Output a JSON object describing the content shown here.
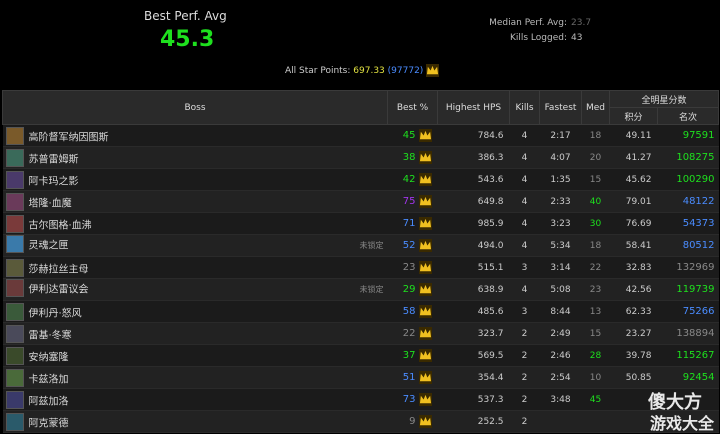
{
  "summary": {
    "best_perf_label": "Best Perf. Avg",
    "best_perf_value": "45.3",
    "median_label": "Median Perf. Avg:",
    "median_value": "23.7",
    "kills_label": "Kills Logged:",
    "kills_value": "43",
    "allstar_label": "All Star Points:",
    "allstar_points": "697.33",
    "allstar_rank": "(97772)"
  },
  "table": {
    "headers": {
      "boss": "Boss",
      "best": "Best %",
      "hps": "Highest HPS",
      "kills": "Kills",
      "fastest": "Fastest",
      "med": "Med",
      "allstar_group": "全明星分数",
      "points": "积分",
      "rank": "名次"
    },
    "rows": [
      {
        "name": "高阶督军纳因图斯",
        "icon_color": "#7a5a2a",
        "locked": "",
        "best": "45",
        "best_color": "#1ee01e",
        "hps": "784.6",
        "kills": "4",
        "fastest": "2:17",
        "med": "18",
        "med_color": "#888888",
        "points": "49.11",
        "rank": "97591",
        "rank_color": "#1ee01e"
      },
      {
        "name": "苏普雷姆斯",
        "icon_color": "#3a6a5a",
        "locked": "",
        "best": "38",
        "best_color": "#1ee01e",
        "hps": "386.3",
        "kills": "4",
        "fastest": "4:07",
        "med": "20",
        "med_color": "#888888",
        "points": "41.27",
        "rank": "108275",
        "rank_color": "#1ee01e"
      },
      {
        "name": "阿卡玛之影",
        "icon_color": "#4a3a6a",
        "locked": "",
        "best": "42",
        "best_color": "#1ee01e",
        "hps": "543.6",
        "kills": "4",
        "fastest": "1:35",
        "med": "15",
        "med_color": "#888888",
        "points": "45.62",
        "rank": "100290",
        "rank_color": "#1ee01e"
      },
      {
        "name": "塔隆·血魔",
        "icon_color": "#6a3a5a",
        "locked": "",
        "best": "75",
        "best_color": "#a335ee",
        "hps": "649.8",
        "kills": "4",
        "fastest": "2:33",
        "med": "40",
        "med_color": "#1ee01e",
        "points": "79.01",
        "rank": "48122",
        "rank_color": "#4a8cff"
      },
      {
        "name": "古尔图格·血沸",
        "icon_color": "#7a3a3a",
        "locked": "",
        "best": "71",
        "best_color": "#4a8cff",
        "hps": "985.9",
        "kills": "4",
        "fastest": "3:23",
        "med": "30",
        "med_color": "#1ee01e",
        "points": "76.69",
        "rank": "54373",
        "rank_color": "#4a8cff"
      },
      {
        "name": "灵魂之匣",
        "icon_color": "#3a7aaa",
        "locked": "未锁定",
        "best": "52",
        "best_color": "#4a8cff",
        "hps": "494.0",
        "kills": "4",
        "fastest": "5:34",
        "med": "18",
        "med_color": "#888888",
        "points": "58.41",
        "rank": "80512",
        "rank_color": "#4a8cff"
      },
      {
        "name": "莎赫拉丝主母",
        "icon_color": "#5a5a3a",
        "locked": "",
        "best": "23",
        "best_color": "#888888",
        "hps": "515.1",
        "kills": "3",
        "fastest": "3:14",
        "med": "22",
        "med_color": "#888888",
        "points": "32.83",
        "rank": "132969",
        "rank_color": "#888888"
      },
      {
        "name": "伊利达雷议会",
        "icon_color": "#6a3a3a",
        "locked": "未锁定",
        "best": "29",
        "best_color": "#1ee01e",
        "hps": "638.9",
        "kills": "4",
        "fastest": "5:08",
        "med": "23",
        "med_color": "#888888",
        "points": "42.56",
        "rank": "119739",
        "rank_color": "#1ee01e"
      },
      {
        "name": "伊利丹·怒风",
        "icon_color": "#3a5a3a",
        "locked": "",
        "best": "58",
        "best_color": "#4a8cff",
        "hps": "485.6",
        "kills": "3",
        "fastest": "8:44",
        "med": "13",
        "med_color": "#888888",
        "points": "62.33",
        "rank": "75266",
        "rank_color": "#4a8cff"
      },
      {
        "name": "雷基·冬寒",
        "icon_color": "#4a4a5a",
        "locked": "",
        "best": "22",
        "best_color": "#888888",
        "hps": "323.7",
        "kills": "2",
        "fastest": "2:49",
        "med": "15",
        "med_color": "#888888",
        "points": "23.27",
        "rank": "138894",
        "rank_color": "#888888"
      },
      {
        "name": "安纳塞隆",
        "icon_color": "#3a4a2a",
        "locked": "",
        "best": "37",
        "best_color": "#1ee01e",
        "hps": "569.5",
        "kills": "2",
        "fastest": "2:46",
        "med": "28",
        "med_color": "#1ee01e",
        "points": "39.78",
        "rank": "115267",
        "rank_color": "#1ee01e"
      },
      {
        "name": "卡兹洛加",
        "icon_color": "#4a6a3a",
        "locked": "",
        "best": "51",
        "best_color": "#4a8cff",
        "hps": "354.4",
        "kills": "2",
        "fastest": "2:54",
        "med": "10",
        "med_color": "#888888",
        "points": "50.85",
        "rank": "92454",
        "rank_color": "#1ee01e"
      },
      {
        "name": "阿兹加洛",
        "icon_color": "#3a3a6a",
        "locked": "",
        "best": "73",
        "best_color": "#4a8cff",
        "hps": "537.3",
        "kills": "2",
        "fastest": "3:48",
        "med": "45",
        "med_color": "#1ee01e",
        "points": "",
        "rank": "",
        "rank_color": "#1ee01e"
      },
      {
        "name": "阿克蒙德",
        "icon_color": "#2a5a6a",
        "locked": "",
        "best": "9",
        "best_color": "#888888",
        "hps": "252.5",
        "kills": "2",
        "fastest": "",
        "med": "",
        "med_color": "#888888",
        "points": "",
        "rank": "",
        "rank_color": "#888888"
      }
    ]
  },
  "watermark": {
    "line1": "傻大方",
    "line2": "游戏大全"
  },
  "icons": {
    "crown": "crown-icon"
  },
  "colors": {
    "accent_green": "#1ee01e",
    "blue": "#4a8cff",
    "purple": "#a335ee",
    "gold": "#e0e040"
  }
}
